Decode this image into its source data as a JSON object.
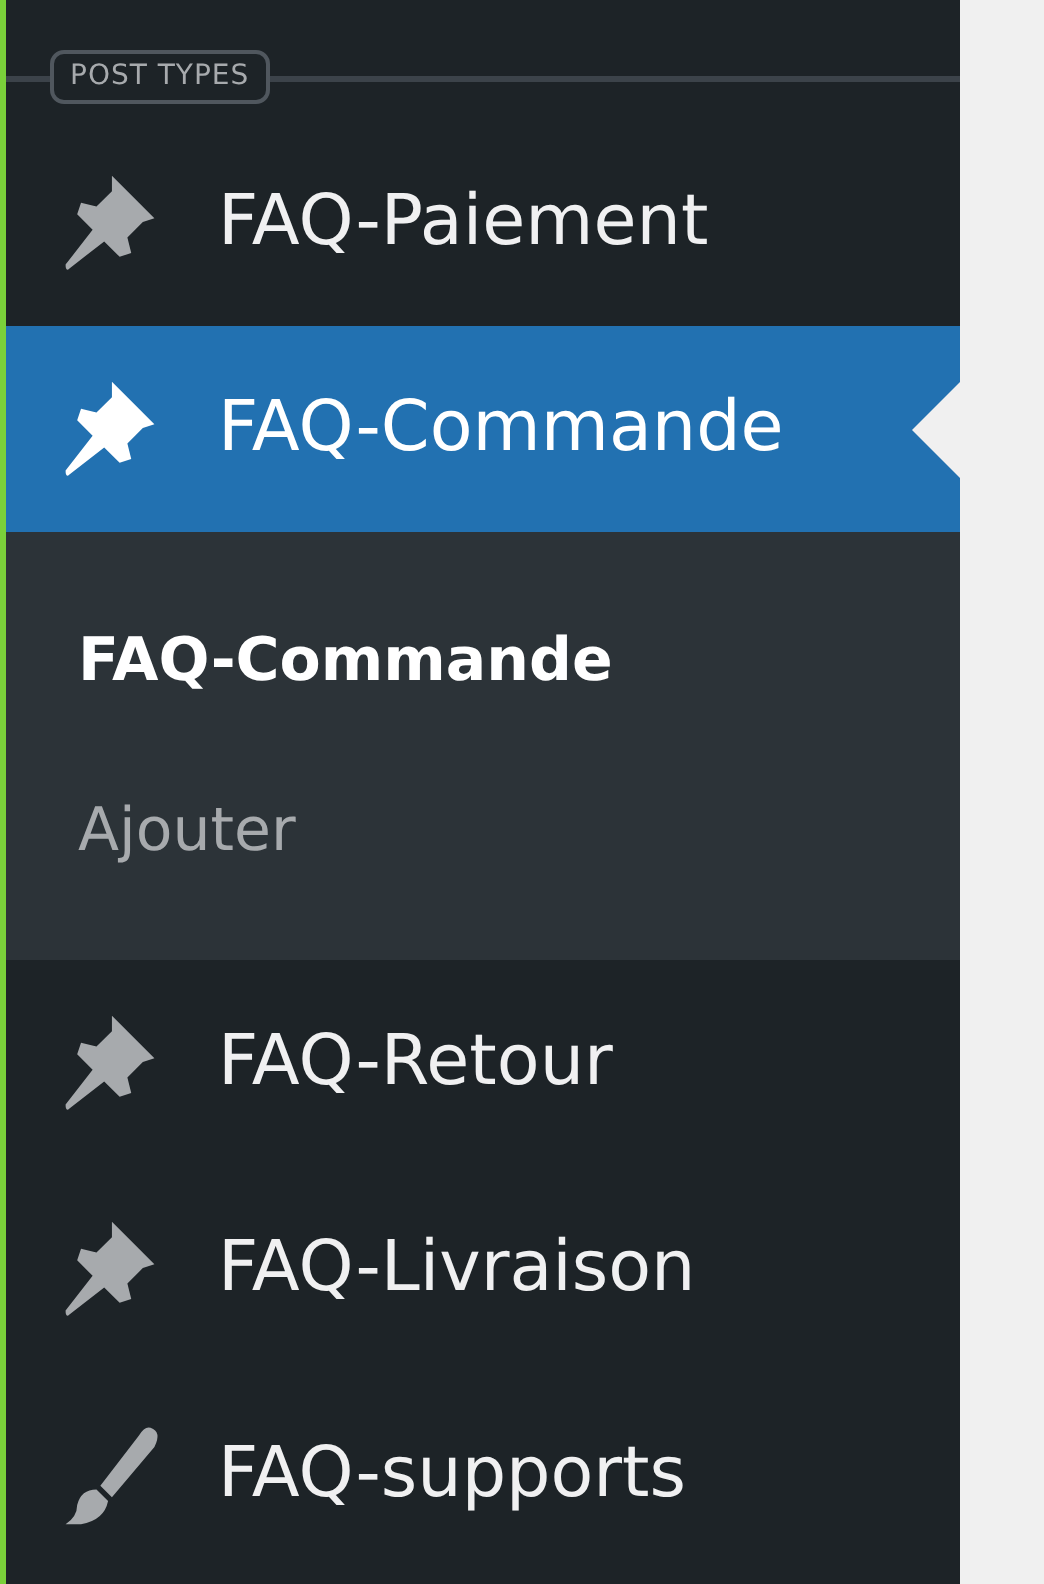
{
  "section_label": "POST TYPES",
  "menu": [
    {
      "label": "FAQ-Paiement",
      "kind": "pin",
      "selected": false
    },
    {
      "label": "FAQ-Commande",
      "kind": "pin",
      "selected": true,
      "submenu": [
        {
          "label": "FAQ-Commande",
          "selected": true
        },
        {
          "label": "Ajouter",
          "selected": false
        }
      ]
    },
    {
      "label": "FAQ-Retour",
      "kind": "pin",
      "selected": false
    },
    {
      "label": "FAQ-Livraison",
      "kind": "pin",
      "selected": false
    },
    {
      "label": "FAQ-supports",
      "kind": "brush",
      "selected": false
    }
  ]
}
